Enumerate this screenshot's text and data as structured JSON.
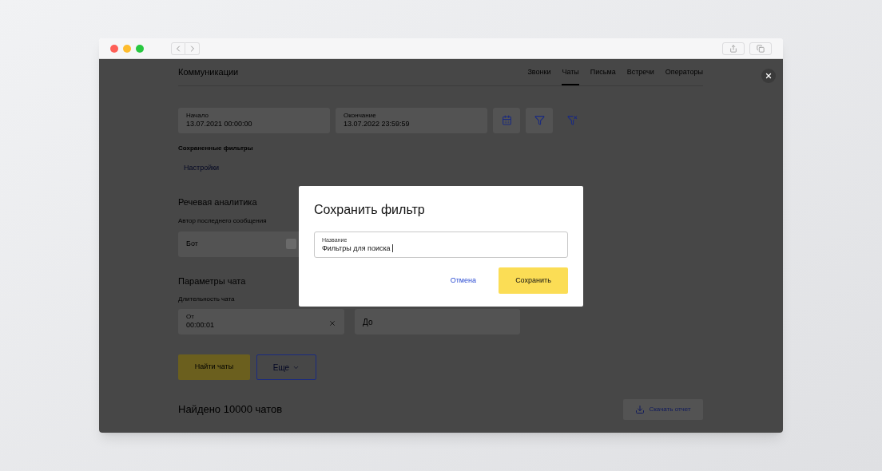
{
  "page": {
    "title": "Коммуникации",
    "tabs": [
      {
        "label": "Звонки",
        "selected": false
      },
      {
        "label": "Чаты",
        "selected": true
      },
      {
        "label": "Письма",
        "selected": false
      },
      {
        "label": "Встречи",
        "selected": false
      },
      {
        "label": "Операторы",
        "selected": false
      }
    ],
    "period": {
      "start": {
        "label": "Начало",
        "value": "13.07.2021 00:00:00"
      },
      "end": {
        "label": "Окончание",
        "value": "13.07.2022 23:59:59"
      }
    },
    "saved_filters": {
      "title": "Сохраненные фильтры",
      "settings_link": "Настройки"
    },
    "speech_analytics": {
      "title": "Речевая аналитика",
      "author_label": "Автор последнего сообщения",
      "author_value": "Бот"
    },
    "chat_params": {
      "title": "Параметры чата",
      "duration_label": "Длительность чата",
      "from": {
        "label": "От",
        "value": "00:00:01"
      },
      "to": {
        "placeholder": "До"
      }
    },
    "find_button": "Найти чаты",
    "more_button": "Еще",
    "found_prefix": "Найдено",
    "found_count": "10000",
    "found_suffix": "чатов",
    "download_button": "Скачать отчет"
  },
  "dialog": {
    "title": "Сохранить фильтр",
    "field": {
      "label": "Название",
      "value": "Фильтры для поиска"
    },
    "cancel": "Отмена",
    "save": "Сохранить"
  }
}
